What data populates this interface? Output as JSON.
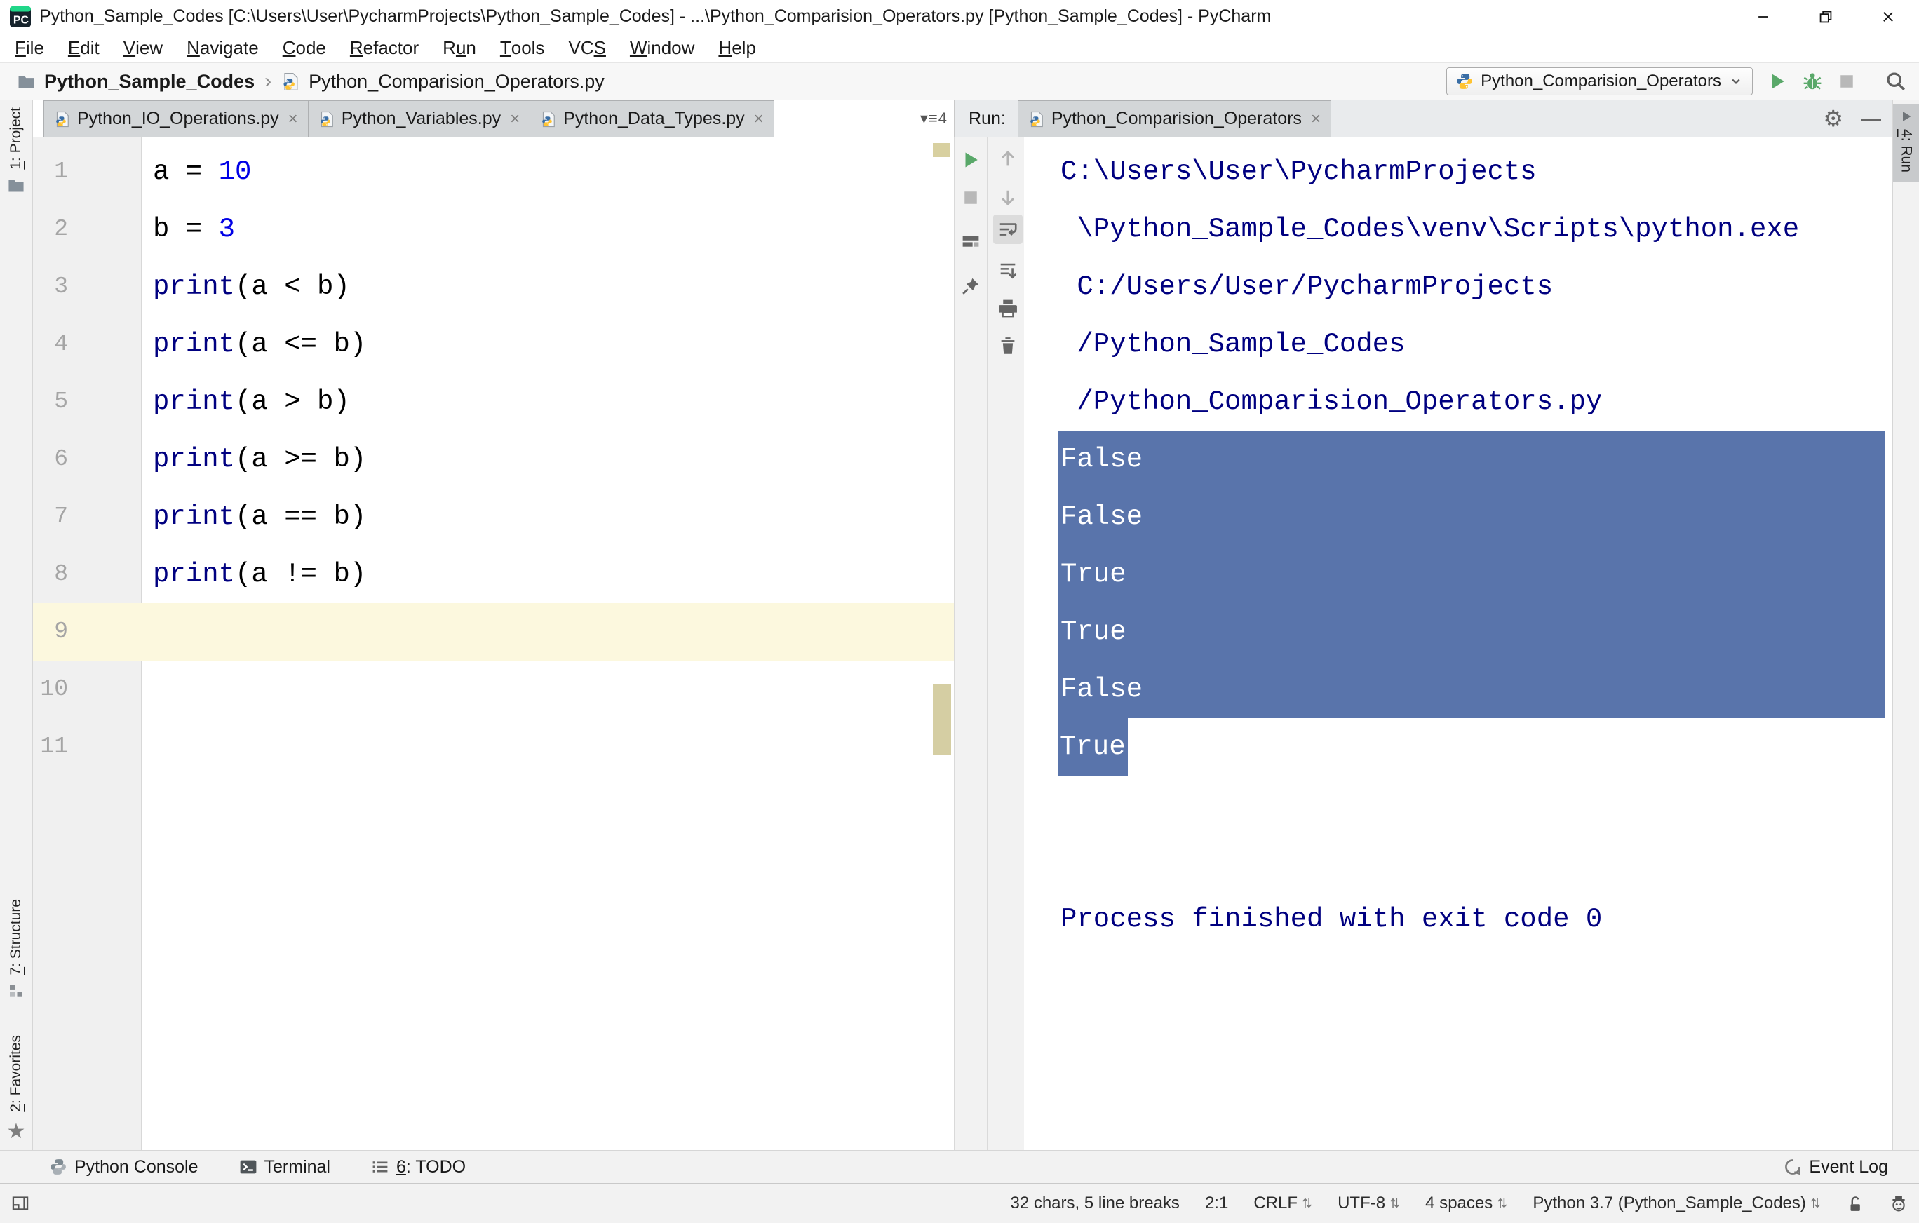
{
  "window": {
    "title": "Python_Sample_Codes [C:\\Users\\User\\PycharmProjects\\Python_Sample_Codes] - ...\\Python_Comparision_Operators.py [Python_Sample_Codes] - PyCharm"
  },
  "menu": {
    "items": [
      {
        "pre": "",
        "mn": "F",
        "post": "ile"
      },
      {
        "pre": "",
        "mn": "E",
        "post": "dit"
      },
      {
        "pre": "",
        "mn": "V",
        "post": "iew"
      },
      {
        "pre": "",
        "mn": "N",
        "post": "avigate"
      },
      {
        "pre": "",
        "mn": "C",
        "post": "ode"
      },
      {
        "pre": "",
        "mn": "R",
        "post": "efactor"
      },
      {
        "pre": "R",
        "mn": "u",
        "post": "n"
      },
      {
        "pre": "",
        "mn": "T",
        "post": "ools"
      },
      {
        "pre": "VC",
        "mn": "S",
        "post": ""
      },
      {
        "pre": "",
        "mn": "W",
        "post": "indow"
      },
      {
        "pre": "",
        "mn": "H",
        "post": "elp"
      }
    ]
  },
  "breadcrumb": {
    "project": "Python_Sample_Codes",
    "file": "Python_Comparision_Operators.py"
  },
  "run_config": {
    "name": "Python_Comparision_Operators"
  },
  "tabs": {
    "editor": [
      "Python_IO_Operations.py",
      "Python_Variables.py",
      "Python_Data_Types.py"
    ],
    "hidden_count": "4",
    "run_prefix": "Run:",
    "run_tab": "Python_Comparision_Operators"
  },
  "editor": {
    "line_numbers": [
      "1",
      "2",
      "3",
      "4",
      "5",
      "6",
      "7",
      "8",
      "9",
      "10",
      "11"
    ],
    "current_line": "9",
    "lines": [
      {
        "parts": [
          "a = ",
          "10"
        ]
      },
      {
        "parts": [
          "b = ",
          "3"
        ]
      },
      {
        "parts": [
          "print",
          "(a < b)"
        ]
      },
      {
        "parts": [
          "print",
          "(a <= b)"
        ]
      },
      {
        "parts": [
          "print",
          "(a > b)"
        ]
      },
      {
        "parts": [
          "print",
          "(a >= b)"
        ]
      },
      {
        "parts": [
          "print",
          "(a == b)"
        ]
      },
      {
        "parts": [
          "print",
          "(a != b)"
        ]
      }
    ]
  },
  "console": {
    "lines": [
      "C:\\Users\\User\\PycharmProjects",
      " \\Python_Sample_Codes\\venv\\Scripts\\python.exe",
      " C:/Users/User/PycharmProjects",
      " /Python_Sample_Codes",
      " /Python_Comparision_Operators.py",
      "False",
      "False",
      "True",
      "True",
      "False",
      "True",
      "",
      "",
      "Process finished with exit code 0"
    ]
  },
  "stripes": {
    "project": {
      "mn": "1",
      "rest": ": Project"
    },
    "structure": {
      "mn": "7",
      "rest": ": Structure"
    },
    "favorites": {
      "mn": "2",
      "rest": ": Favorites"
    },
    "run": {
      "mn": "4",
      "rest": ": Run"
    }
  },
  "bottom": {
    "python_console": "Python Console",
    "terminal": "Terminal",
    "todo": {
      "mn": "6",
      "rest": ": TODO"
    },
    "event_log": "Event Log"
  },
  "status": {
    "chars": "32 chars, 5 line breaks",
    "position": "2:1",
    "line_sep": "CRLF",
    "encoding": "UTF-8",
    "indent": "4 spaces",
    "interpreter": "Python 3.7 (Python_Sample_Codes)"
  },
  "icons": {
    "gear": "⚙",
    "hide": "—",
    "dropdown": "▾",
    "list": "≡",
    "star": "★",
    "updown": "⇅",
    "crumb_sep": "›",
    "close": "×"
  },
  "colors": {
    "selection": "#5974AB",
    "selection_text": "#FFFFFF",
    "current_line": "#FCF8DE",
    "console_text": "#000080",
    "builtin": "#000080",
    "number_literal": "#0000E6",
    "run_green": "#59A869",
    "caret_row_gutter": "#F0F0F0"
  }
}
